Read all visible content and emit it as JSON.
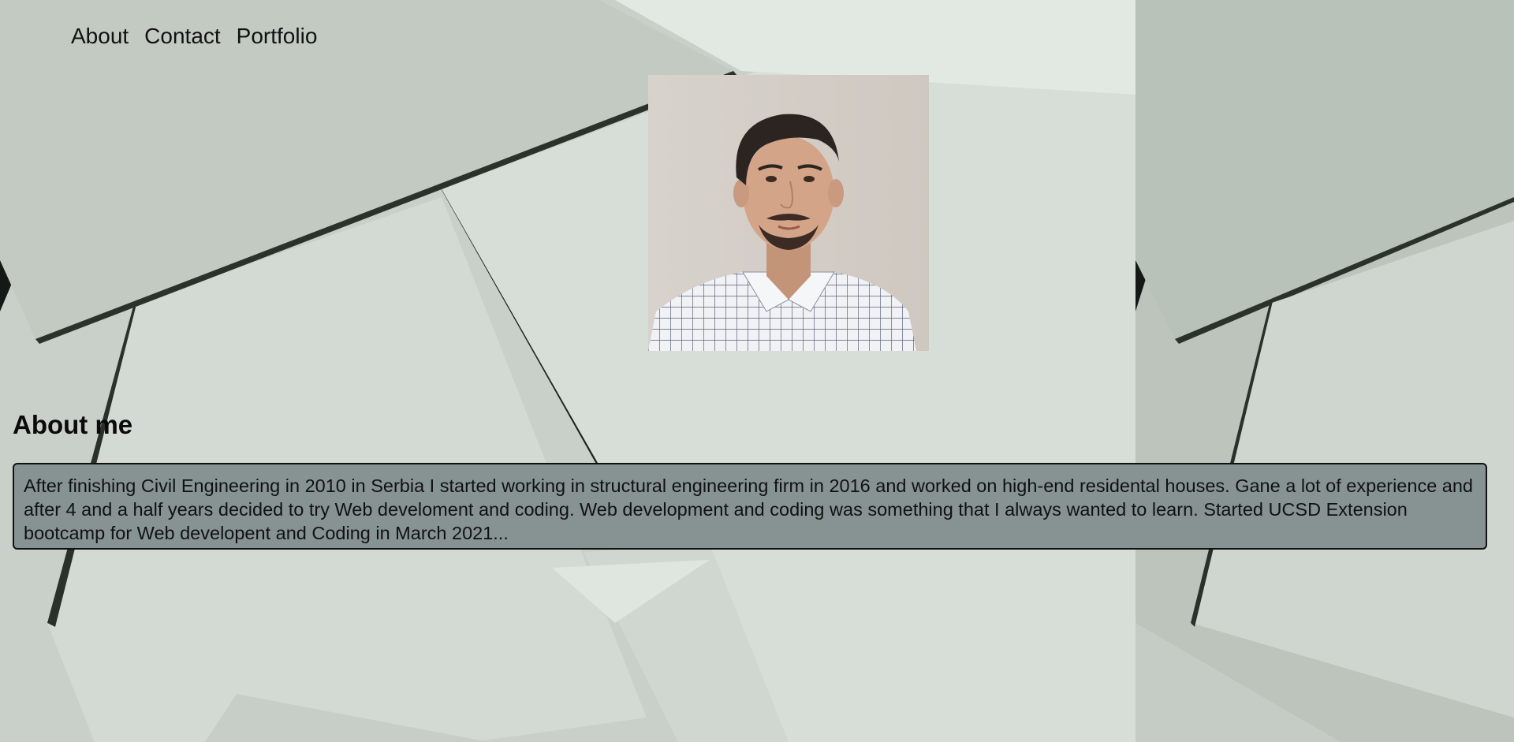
{
  "nav": {
    "items": [
      {
        "label": "About"
      },
      {
        "label": "Contact"
      },
      {
        "label": "Portfolio"
      }
    ]
  },
  "about": {
    "title": "About me",
    "body": "After finishing Civil Engineering in 2010 in Serbia I started working in structural engineering firm in 2016 and worked on high-end residental houses. Gane a lot of experience and after 4 and a half years decided to try Web develoment and coding. Web development and coding was something that I always wanted to learn. Started UCSD Extension bootcamp for Web developent and Coding in March 2021..."
  },
  "colors": {
    "paper_light": "#dde3dd",
    "paper_mid": "#c7cfc7",
    "paper_shadow": "#1c211c",
    "about_box_bg": "#869392"
  }
}
